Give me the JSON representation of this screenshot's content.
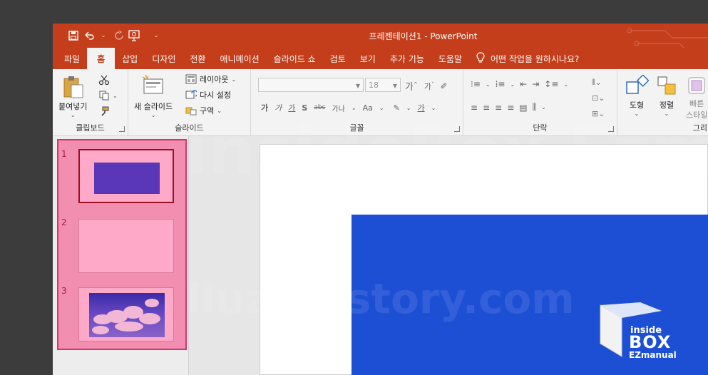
{
  "window": {
    "title": "프레젠테이션1 - PowerPoint"
  },
  "tabs": [
    {
      "label": "파일"
    },
    {
      "label": "홈"
    },
    {
      "label": "삽입"
    },
    {
      "label": "디자인"
    },
    {
      "label": "전환"
    },
    {
      "label": "애니메이션"
    },
    {
      "label": "슬라이드 쇼"
    },
    {
      "label": "검토"
    },
    {
      "label": "보기"
    },
    {
      "label": "추가 기능"
    },
    {
      "label": "도움말"
    }
  ],
  "tell_me": "어떤 작업을 원하시나요?",
  "ribbon": {
    "clipboard": {
      "paste": "붙여넣기",
      "label": "클립보드"
    },
    "slides": {
      "new_slide": "새 슬라이드",
      "layout": "레이아웃",
      "reset": "다시 설정",
      "section": "구역",
      "label": "슬라이드"
    },
    "font": {
      "font_name": "",
      "font_size": "18",
      "label": "글꼴",
      "buttons": [
        "가",
        "가",
        "가",
        "S",
        "abc",
        "가나",
        "Aa"
      ]
    },
    "paragraph": {
      "label": "단락"
    },
    "drawing": {
      "shape": "도형",
      "arrange": "정렬",
      "quick_style": "빠른",
      "quick_style_2": "스타일",
      "label": "그리"
    }
  },
  "slides": [
    {
      "number": "1"
    },
    {
      "number": "2"
    },
    {
      "number": "3"
    }
  ],
  "watermark": {
    "line1": "insideBox Ezmanual",
    "line2": "lluze.tistory.com"
  },
  "logo": {
    "line1": "inside",
    "line2": "BOX",
    "line3": "EZmanual"
  },
  "colors": {
    "title_bar": "#c43e1c",
    "highlight": "#f28eb0",
    "slide_blue": "#1c4fd4",
    "marker": "#ff1e5e"
  }
}
